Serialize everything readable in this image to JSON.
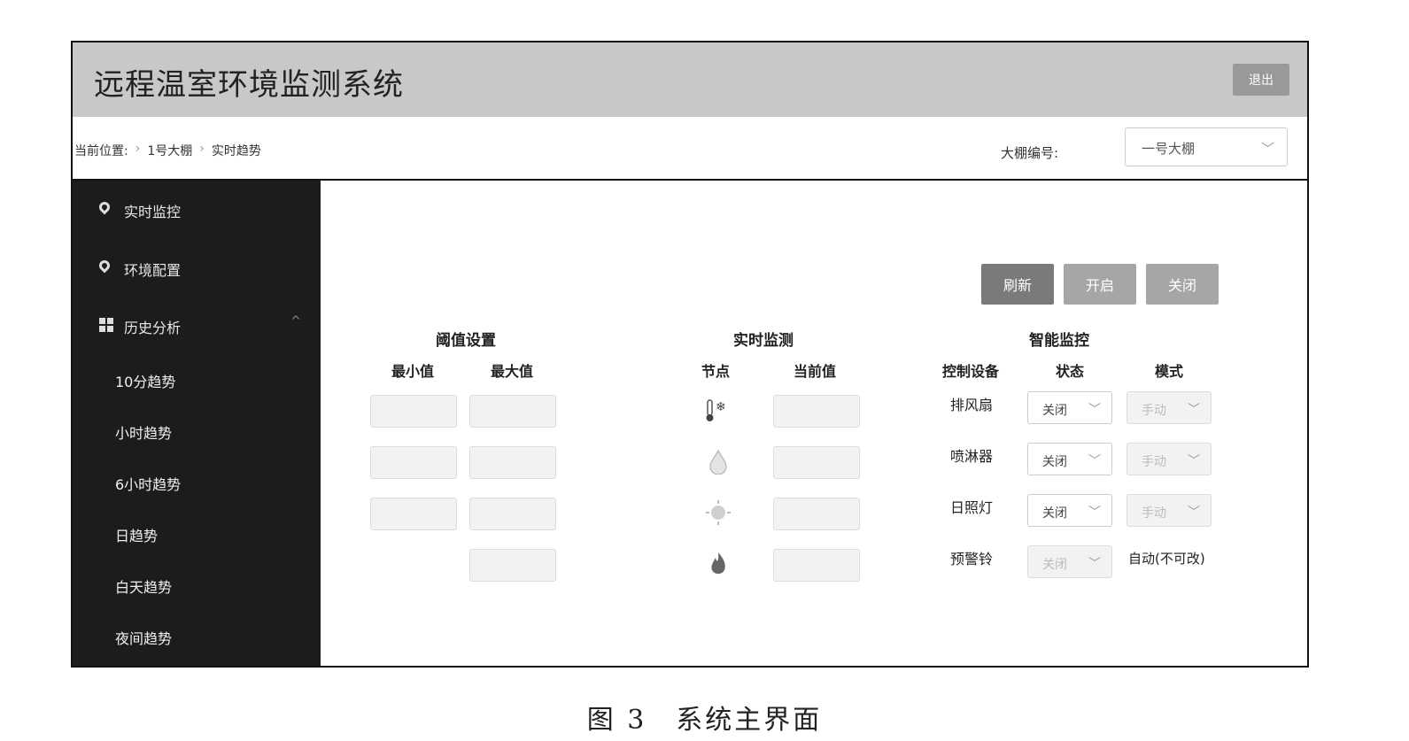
{
  "header": {
    "title": "远程温室环境监测系统",
    "logout_label": "退出"
  },
  "breadcrumb": {
    "prefix": "当前位置:",
    "items": [
      "1号大棚",
      "实时趋势"
    ],
    "separator": "›"
  },
  "greenhouse": {
    "label": "大棚编号:",
    "selected": "一号大棚"
  },
  "sidebar": {
    "items": [
      {
        "label": "实时监控",
        "icon": "location-pin-icon"
      },
      {
        "label": "环境配置",
        "icon": "location-pin-icon"
      },
      {
        "label": "历史分析",
        "icon": "grid-icon"
      }
    ],
    "sub_items": [
      "10分趋势",
      "小时趋势",
      "6小时趋势",
      "日趋势",
      "白天趋势",
      "夜间趋势"
    ]
  },
  "actions": {
    "refresh": "刷新",
    "open": "开启",
    "close": "关闭"
  },
  "threshold": {
    "title": "阈值设置",
    "min_label": "最小值",
    "max_label": "最大值"
  },
  "monitor": {
    "title": "实时监测",
    "node_label": "节点",
    "value_label": "当前值",
    "sensors": [
      "thermometer-icon",
      "water-drop-icon",
      "sun-icon",
      "flame-icon"
    ]
  },
  "smart": {
    "title": "智能监控",
    "device_label": "控制设备",
    "status_label": "状态",
    "mode_label": "模式",
    "devices": [
      {
        "name": "排风扇",
        "status": "关闭",
        "mode": "手动"
      },
      {
        "name": "喷淋器",
        "status": "关闭",
        "mode": "手动"
      },
      {
        "name": "日照灯",
        "status": "关闭",
        "mode": "手动"
      },
      {
        "name": "预警铃",
        "status": "关闭",
        "mode": "自动(不可改)"
      }
    ]
  },
  "caption": "图 3　系统主界面",
  "colors": {
    "topbar": "#c8c8c8",
    "sidebar": "#1c1c1c",
    "btn_dark": "#7a7a7a",
    "btn_light": "#a6a6a6"
  }
}
